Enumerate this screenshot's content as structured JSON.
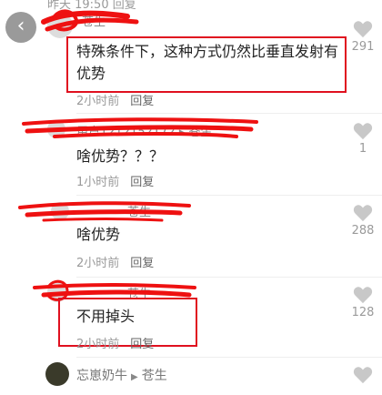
{
  "top_meta": "昨天 19:50  回复",
  "comments": [
    {
      "user": "苍生",
      "text": "特殊条件下，这种方式仍然比垂直发射有优势",
      "time": "2小时前",
      "reply": "回复",
      "likes": "291"
    },
    {
      "user": "用户1212152172 ▸ 苍生",
      "text": "啥优势？？？",
      "time": "1小时前",
      "reply": "回复",
      "likes": "1"
    },
    {
      "user": "苍生",
      "text": "啥优势",
      "time": "2小时前",
      "reply": "回复",
      "likes": "288"
    },
    {
      "user": "苍生",
      "text": "不用掉头",
      "time": "2小时前",
      "reply": "回复",
      "likes": "128"
    }
  ],
  "last_row": {
    "user": "忘崽奶牛",
    "arrow": "▶",
    "target": "苍生"
  },
  "colors": {
    "highlight_red": "#e0101f",
    "scribble_red": "#ee1111"
  },
  "icons": {
    "back": "chevron-left",
    "like": "heart"
  }
}
